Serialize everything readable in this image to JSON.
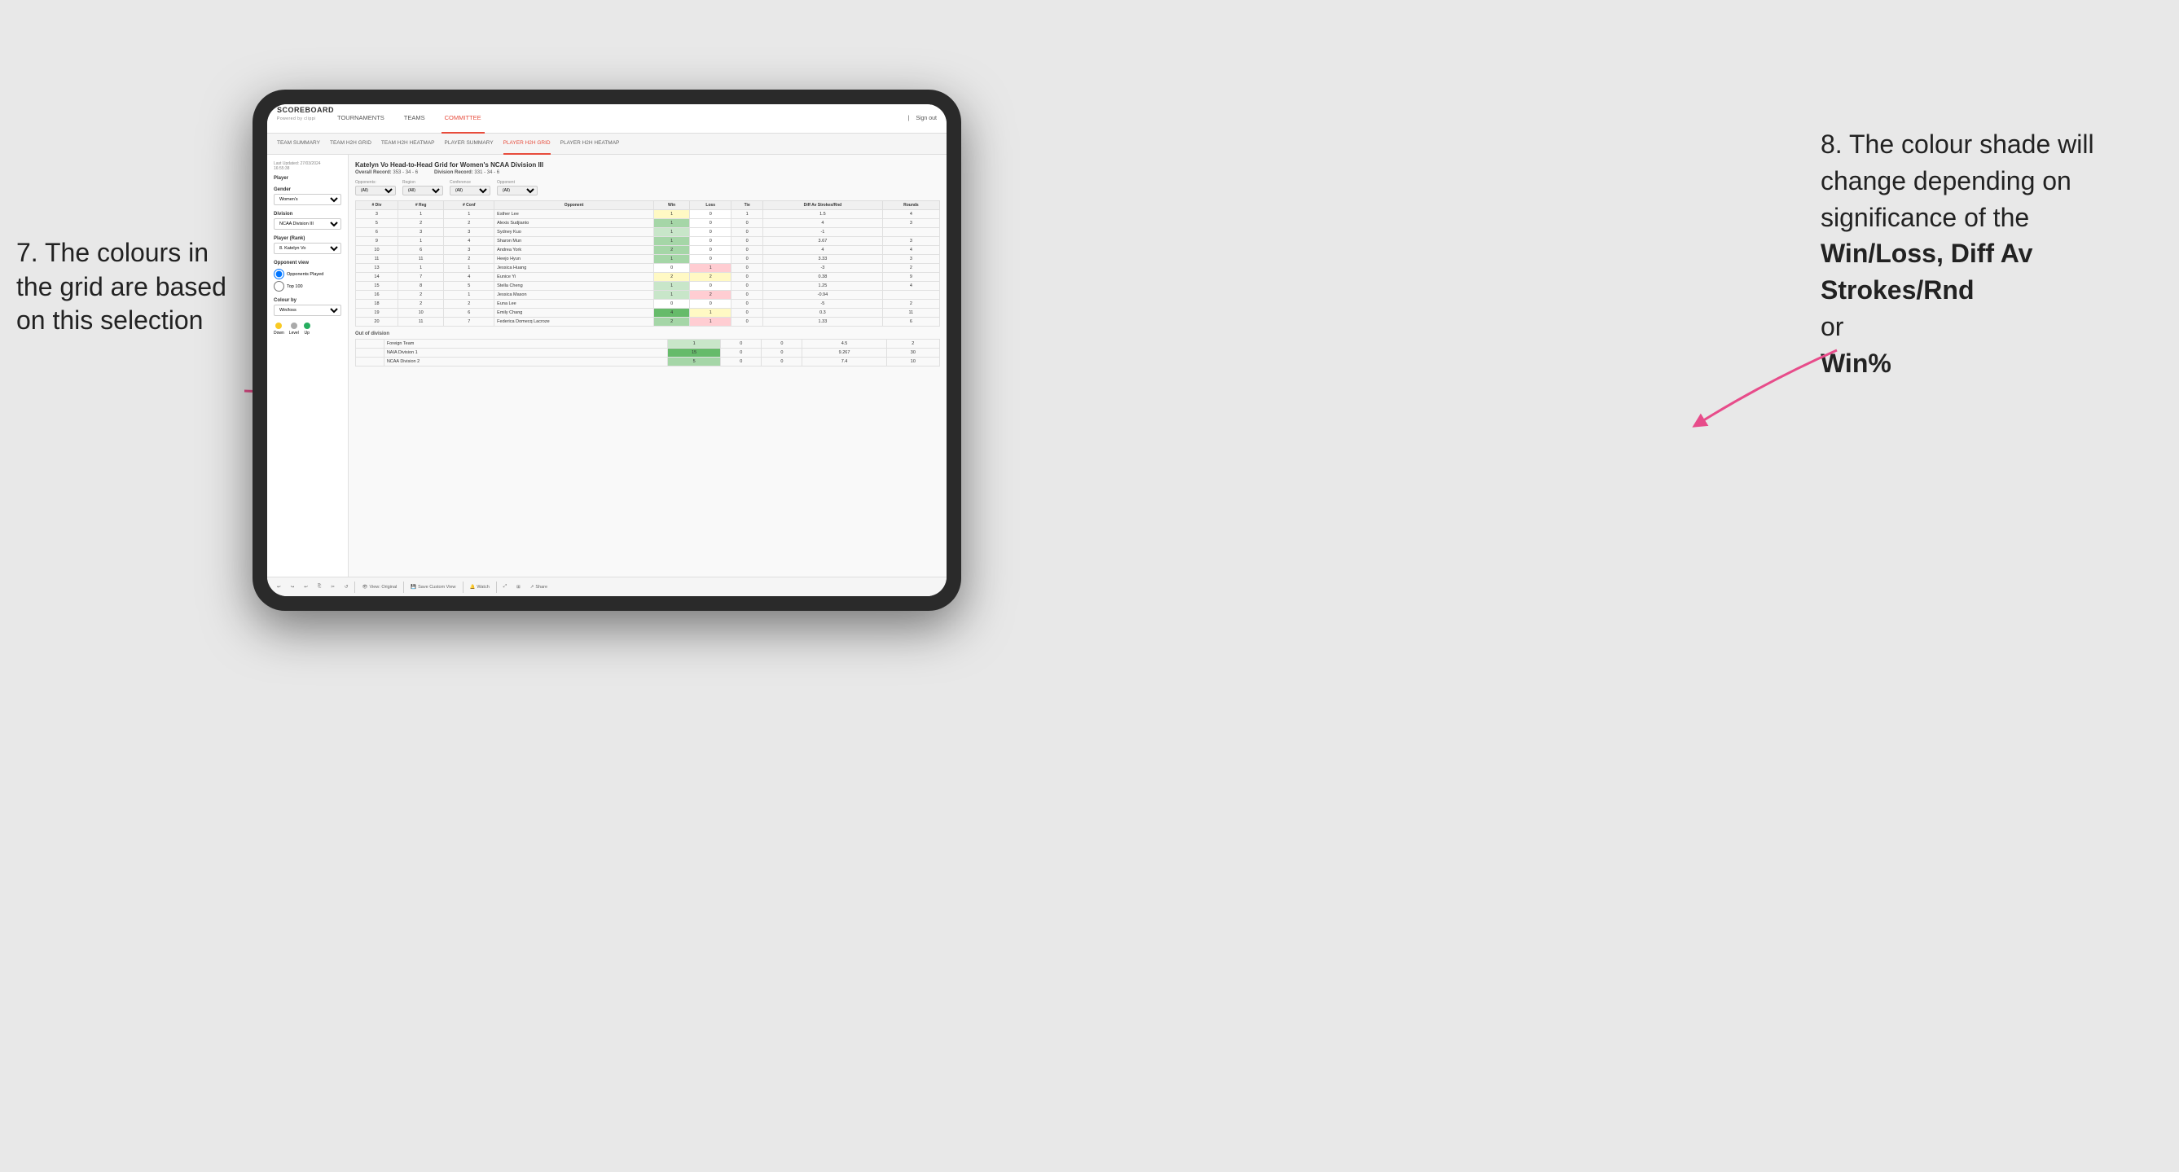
{
  "annotations": {
    "left_title": "7. The colours in the grid are based on this selection",
    "right_title": "8. The colour shade will change depending on significance of the",
    "right_bold1": "Win/Loss,",
    "right_bold2": "Diff Av Strokes/Rnd",
    "right_or": "or",
    "right_bold3": "Win%"
  },
  "nav": {
    "logo": "SCOREBOARD",
    "logo_sub": "Powered by clippi",
    "items": [
      "TOURNAMENTS",
      "TEAMS",
      "COMMITTEE"
    ],
    "active": "COMMITTEE",
    "sign_in": "Sign out"
  },
  "sub_nav": {
    "items": [
      "TEAM SUMMARY",
      "TEAM H2H GRID",
      "TEAM H2H HEATMAP",
      "PLAYER SUMMARY",
      "PLAYER H2H GRID",
      "PLAYER H2H HEATMAP"
    ],
    "active": "PLAYER H2H GRID"
  },
  "sidebar": {
    "last_updated_label": "Last Updated: 27/03/2024",
    "last_updated_time": "16:55:38",
    "player_section": "Player",
    "gender_label": "Gender",
    "gender_value": "Women's",
    "division_label": "Division",
    "division_value": "NCAA Division III",
    "player_rank_label": "Player (Rank)",
    "player_rank_value": "8. Katelyn Vo",
    "opponent_view_label": "Opponent view",
    "radio1": "Opponents Played",
    "radio2": "Top 100",
    "colour_by_label": "Colour by",
    "colour_by_value": "Win/loss",
    "legend": {
      "down_label": "Down",
      "level_label": "Level",
      "up_label": "Up"
    }
  },
  "grid": {
    "title": "Katelyn Vo Head-to-Head Grid for Women's NCAA Division III",
    "overall_record_label": "Overall Record:",
    "overall_record": "353 - 34 - 6",
    "division_record_label": "Division Record:",
    "division_record": "331 - 34 - 6",
    "opponents_label": "Opponents:",
    "opponents_value": "(All)",
    "region_label": "Region",
    "region_value": "(All)",
    "conference_label": "Conference",
    "conference_value": "(All)",
    "opponent_label": "Opponent",
    "opponent_value": "(All)",
    "col_headers": [
      "#",
      "#",
      "#",
      "Opponent",
      "Win",
      "Loss",
      "Tie",
      "Diff Av Strokes/Rnd",
      "Rounds"
    ],
    "col_sub_headers": [
      "Div",
      "Reg",
      "Conf"
    ],
    "rows": [
      {
        "div": "3",
        "reg": "1",
        "conf": "1",
        "opponent": "Esther Lee",
        "win": 1,
        "loss": 0,
        "tie": 1,
        "diff": 1.5,
        "rounds": 4,
        "win_color": "yellow",
        "loss_color": "white"
      },
      {
        "div": "5",
        "reg": "2",
        "conf": "2",
        "opponent": "Alexis Sudjianto",
        "win": 1,
        "loss": 0,
        "tie": 0,
        "diff": 4.0,
        "rounds": 3,
        "win_color": "green-mid",
        "loss_color": "white"
      },
      {
        "div": "6",
        "reg": "3",
        "conf": "3",
        "opponent": "Sydney Kuo",
        "win": 1,
        "loss": 0,
        "tie": 0,
        "diff": -1.0,
        "rounds": "",
        "win_color": "green-light",
        "loss_color": "white"
      },
      {
        "div": "9",
        "reg": "1",
        "conf": "4",
        "opponent": "Sharon Mun",
        "win": 1,
        "loss": 0,
        "tie": 0,
        "diff": 3.67,
        "rounds": 3,
        "win_color": "green-mid",
        "loss_color": "white"
      },
      {
        "div": "10",
        "reg": "6",
        "conf": "3",
        "opponent": "Andrea York",
        "win": 2,
        "loss": 0,
        "tie": 0,
        "diff": 4.0,
        "rounds": 4,
        "win_color": "green-mid",
        "loss_color": "white"
      },
      {
        "div": "11",
        "reg": "11",
        "conf": "2",
        "opponent": "Heejo Hyun",
        "win": 1,
        "loss": 0,
        "tie": 0,
        "diff": 3.33,
        "rounds": 3,
        "win_color": "green-mid",
        "loss_color": "white"
      },
      {
        "div": "13",
        "reg": "1",
        "conf": "1",
        "opponent": "Jessica Huang",
        "win": 0,
        "loss": 1,
        "tie": 0,
        "diff": -3.0,
        "rounds": 2,
        "win_color": "white",
        "loss_color": "red-light"
      },
      {
        "div": "14",
        "reg": "7",
        "conf": "4",
        "opponent": "Eunice Yi",
        "win": 2,
        "loss": 2,
        "tie": 0,
        "diff": 0.38,
        "rounds": 9,
        "win_color": "yellow",
        "loss_color": "yellow"
      },
      {
        "div": "15",
        "reg": "8",
        "conf": "5",
        "opponent": "Stella Cheng",
        "win": 1,
        "loss": 0,
        "tie": 0,
        "diff": 1.25,
        "rounds": 4,
        "win_color": "green-light",
        "loss_color": "white"
      },
      {
        "div": "16",
        "reg": "2",
        "conf": "1",
        "opponent": "Jessica Mason",
        "win": 1,
        "loss": 2,
        "tie": 0,
        "diff": -0.94,
        "rounds": "",
        "win_color": "green-light",
        "loss_color": "red-light"
      },
      {
        "div": "18",
        "reg": "2",
        "conf": "2",
        "opponent": "Euna Lee",
        "win": 0,
        "loss": 0,
        "tie": 0,
        "diff": -5.0,
        "rounds": 2,
        "win_color": "white",
        "loss_color": "white"
      },
      {
        "div": "19",
        "reg": "10",
        "conf": "6",
        "opponent": "Emily Chang",
        "win": 4,
        "loss": 1,
        "tie": 0,
        "diff": 0.3,
        "rounds": 11,
        "win_color": "green-dark",
        "loss_color": "yellow"
      },
      {
        "div": "20",
        "reg": "11",
        "conf": "7",
        "opponent": "Federica Domecq Lacroze",
        "win": 2,
        "loss": 1,
        "tie": 0,
        "diff": 1.33,
        "rounds": 6,
        "win_color": "green-mid",
        "loss_color": "red-light"
      }
    ],
    "out_of_division_label": "Out of division",
    "out_of_division_rows": [
      {
        "opponent": "Foreign Team",
        "win": 1,
        "loss": 0,
        "tie": 0,
        "diff": 4.5,
        "rounds": 2,
        "win_color": "green-light"
      },
      {
        "opponent": "NAIA Division 1",
        "win": 15,
        "loss": 0,
        "tie": 0,
        "diff": 9.267,
        "rounds": 30,
        "win_color": "green-dark"
      },
      {
        "opponent": "NCAA Division 2",
        "win": 5,
        "loss": 0,
        "tie": 0,
        "diff": 7.4,
        "rounds": 10,
        "win_color": "green-mid"
      }
    ]
  },
  "toolbar": {
    "view_original": "View: Original",
    "save_custom_view": "Save Custom View",
    "watch": "Watch",
    "share": "Share"
  }
}
